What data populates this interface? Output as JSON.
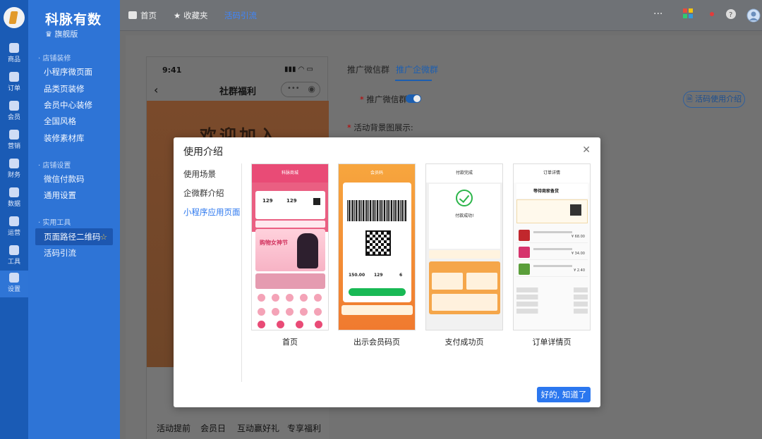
{
  "app": {
    "brand": "科脉有数",
    "edition": "旗舰版"
  },
  "rail": {
    "items": [
      {
        "label": "商品",
        "icon": "product-icon"
      },
      {
        "label": "订单",
        "icon": "order-icon"
      },
      {
        "label": "会员",
        "icon": "member-icon"
      },
      {
        "label": "营销",
        "icon": "marketing-icon"
      },
      {
        "label": "财务",
        "icon": "finance-icon"
      },
      {
        "label": "数据",
        "icon": "data-icon"
      },
      {
        "label": "运营",
        "icon": "operation-icon"
      },
      {
        "label": "工具",
        "icon": "tools-icon"
      },
      {
        "label": "设置",
        "icon": "gear-icon"
      }
    ]
  },
  "sidebar": {
    "sections": [
      {
        "title": "店铺装修",
        "items": [
          "小程序微页面",
          "品类页装修",
          "会员中心装修",
          "全国风格",
          "装修素材库"
        ]
      },
      {
        "title": "店铺设置",
        "items": [
          "微信付款码",
          "通用设置"
        ]
      },
      {
        "title": "实用工具",
        "items": [
          "页面路径二维码",
          "活码引流"
        ]
      }
    ]
  },
  "topbar": {
    "home": "首页",
    "favorites": "收藏夹",
    "current": "活码引流"
  },
  "phone": {
    "time": "9:41",
    "title": "社群福利",
    "banner_text": "欢迎加入",
    "tabs": [
      "活动提前",
      "会员日",
      "互动赢好礼",
      "专享福利"
    ]
  },
  "panel": {
    "tabs": [
      "推广微信群",
      "推广企微群"
    ],
    "field_group_label": "推广微信群:",
    "field_bg_label": "活动背景图展示:",
    "help_button": "活码使用介绍"
  },
  "modal": {
    "title": "使用介绍",
    "menu": [
      "使用场景",
      "企微群介绍",
      "小程序应用页面"
    ],
    "ok_button": "好的, 知道了",
    "thumbs": [
      {
        "caption": "首页",
        "bar_title": "科脉商城",
        "stats": [
          "129",
          "129"
        ],
        "promo": "购物女神节"
      },
      {
        "caption": "出示会员码页",
        "bar_title": "会员码",
        "stats": [
          "150.00",
          "129",
          "6"
        ]
      },
      {
        "caption": "支付成功页",
        "bar_title": "付款完成",
        "ok_text": "付款成功!"
      },
      {
        "caption": "订单详情页",
        "bar_title": "订单详情",
        "head": "等待商家备货",
        "prices": [
          "¥ 68.00",
          "¥ 34.00",
          "¥ 2.40"
        ]
      }
    ]
  },
  "colors": {
    "primary": "#2b77ef",
    "sidebar": "#2e74d6",
    "rail": "#1a5bb5"
  }
}
